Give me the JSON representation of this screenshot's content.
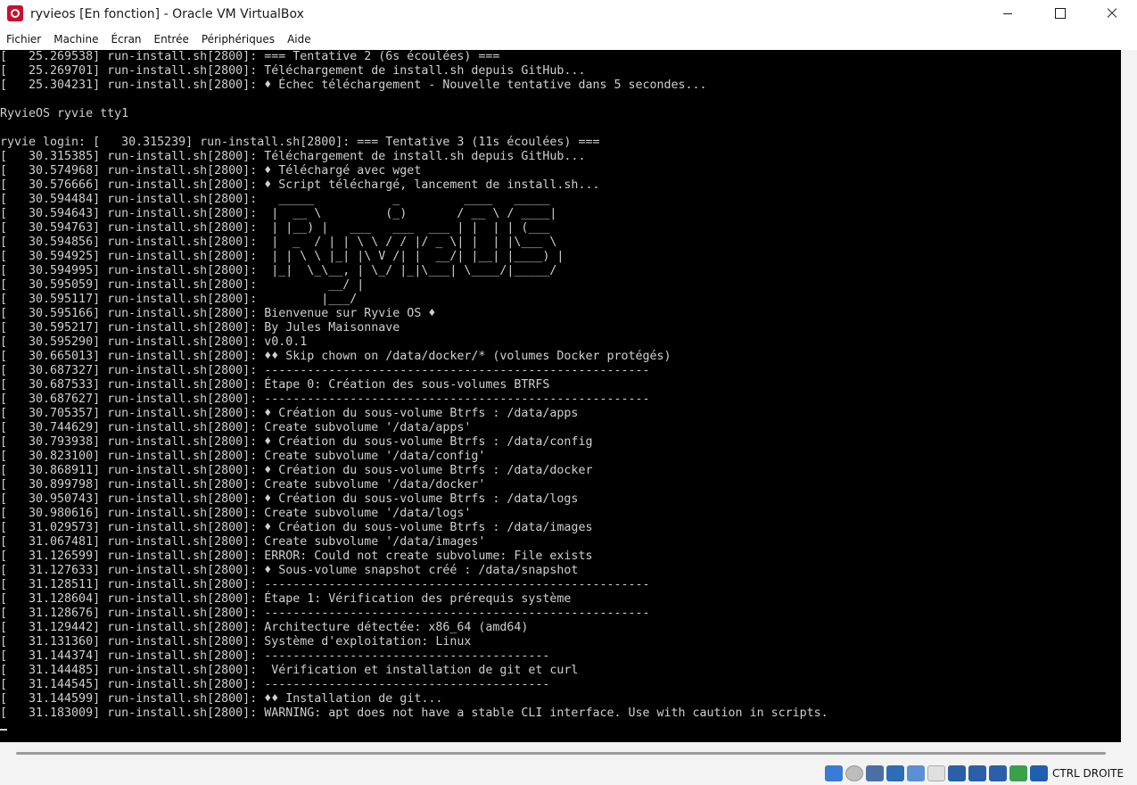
{
  "window": {
    "title": "ryvieos [En fonction] - Oracle VM VirtualBox"
  },
  "menu": [
    "Fichier",
    "Machine",
    "Écran",
    "Entrée",
    "Périphériques",
    "Aide"
  ],
  "console": {
    "lines": [
      "[   25.269538] run-install.sh[2800]: === Tentative 2 (6s écoulées) ===",
      "[   25.269701] run-install.sh[2800]: Téléchargement de install.sh depuis GitHub...",
      "[   25.304231] run-install.sh[2800]: ♦ Échec téléchargement - Nouvelle tentative dans 5 secondes...",
      "",
      "RyvieOS ryvie tty1",
      "",
      "ryvie login: [   30.315239] run-install.sh[2800]: === Tentative 3 (11s écoulées) ===",
      "[   30.315385] run-install.sh[2800]: Téléchargement de install.sh depuis GitHub...",
      "[   30.574968] run-install.sh[2800]: ♦ Téléchargé avec wget",
      "[   30.576666] run-install.sh[2800]: ♦ Script téléchargé, lancement de install.sh...",
      "[   30.594484] run-install.sh[2800]:   _____           _         ____   _____ ",
      "[   30.594643] run-install.sh[2800]:  |  __ \\         (_)       / __ \\ / ____|",
      "[   30.594763] run-install.sh[2800]:  | |__) |   ___   ___  ___ | |  | | (___  ",
      "[   30.594856] run-install.sh[2800]:  |  _  / | | \\ \\ / / |/ _ \\| |  | |\\___ \\ ",
      "[   30.594925] run-install.sh[2800]:  | | \\ \\ |_| |\\ V /| |  __/| |__| |____) |",
      "[   30.594995] run-install.sh[2800]:  |_|  \\_\\__, | \\_/ |_|\\___| \\____/|_____/ ",
      "[   30.595059] run-install.sh[2800]:          __/ |",
      "[   30.595117] run-install.sh[2800]:         |___/",
      "[   30.595166] run-install.sh[2800]: Bienvenue sur Ryvie OS ♦",
      "[   30.595217] run-install.sh[2800]: By Jules Maisonnave",
      "[   30.595290] run-install.sh[2800]: v0.0.1",
      "[   30.665013] run-install.sh[2800]: ♦♦ Skip chown on /data/docker/* (volumes Docker protégés)",
      "[   30.687327] run-install.sh[2800]: ------------------------------------------------------",
      "[   30.687533] run-install.sh[2800]: Étape 0: Création des sous-volumes BTRFS",
      "[   30.687627] run-install.sh[2800]: ------------------------------------------------------",
      "[   30.705357] run-install.sh[2800]: ♦ Création du sous-volume Btrfs : /data/apps",
      "[   30.744629] run-install.sh[2800]: Create subvolume '/data/apps'",
      "[   30.793938] run-install.sh[2800]: ♦ Création du sous-volume Btrfs : /data/config",
      "[   30.823100] run-install.sh[2800]: Create subvolume '/data/config'",
      "[   30.868911] run-install.sh[2800]: ♦ Création du sous-volume Btrfs : /data/docker",
      "[   30.899798] run-install.sh[2800]: Create subvolume '/data/docker'",
      "[   30.950743] run-install.sh[2800]: ♦ Création du sous-volume Btrfs : /data/logs",
      "[   30.980616] run-install.sh[2800]: Create subvolume '/data/logs'",
      "[   31.029573] run-install.sh[2800]: ♦ Création du sous-volume Btrfs : /data/images",
      "[   31.067481] run-install.sh[2800]: Create subvolume '/data/images'",
      "[   31.126599] run-install.sh[2800]: ERROR: Could not create subvolume: File exists",
      "[   31.127633] run-install.sh[2800]: ♦ Sous-volume snapshot créé : /data/snapshot",
      "[   31.128511] run-install.sh[2800]: ------------------------------------------------------",
      "[   31.128604] run-install.sh[2800]: Étape 1: Vérification des prérequis système",
      "[   31.128676] run-install.sh[2800]: ------------------------------------------------------",
      "[   31.129442] run-install.sh[2800]: Architecture détectée: x86_64 (amd64)",
      "[   31.131360] run-install.sh[2800]: Système d'exploitation: Linux",
      "[   31.144374] run-install.sh[2800]: ----------------------------------------",
      "[   31.144485] run-install.sh[2800]:  Vérification et installation de git et curl",
      "[   31.144545] run-install.sh[2800]: ----------------------------------------",
      "[   31.144599] run-install.sh[2800]: ♦♦ Installation de git...",
      "[   31.183009] run-install.sh[2800]: WARNING: apt does not have a stable CLI interface. Use with caution in scripts.",
      ""
    ]
  },
  "statusbar": {
    "icons": [
      "storage-icon",
      "optical-drive-icon",
      "audio-icon",
      "network-icon",
      "usb-icon",
      "shared-folders-icon",
      "display-icon",
      "recording-icon",
      "virtualization-icon",
      "mouse-integration-icon",
      "keyboard-capture-icon"
    ],
    "host_key": "CTRL DROITE"
  }
}
